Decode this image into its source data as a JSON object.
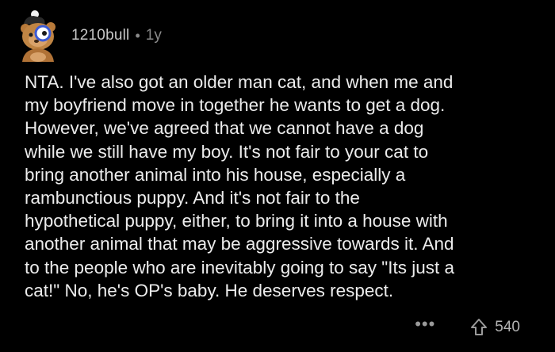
{
  "comment": {
    "author": "1210bull",
    "separator": "•",
    "age": "1y",
    "text": "NTA. I've also got an older man cat, and when me and\nmy boyfriend move in together he wants to get a dog.\nHowever, we've agreed that we cannot have a dog\nwhile we still have my boy. It's not fair to your cat to\nbring another animal into his house, especially a\nrambunctious puppy. And it's not fair to the\nhypothetical puppy, either, to bring it into a house with\nanother animal that may be aggressive towards it. And\nto the people who are inevitably going to say \"Its just a\ncat!\" No, he's OP's baby. He deserves respect.",
    "more_label": "•••",
    "score": "540"
  },
  "icons": {
    "avatar": "bear-avatar-icon",
    "more": "more-options-icon",
    "upvote": "upvote-arrow-icon"
  },
  "colors": {
    "background": "#000000",
    "text": "#ececec",
    "muted": "#8a8a8a"
  }
}
